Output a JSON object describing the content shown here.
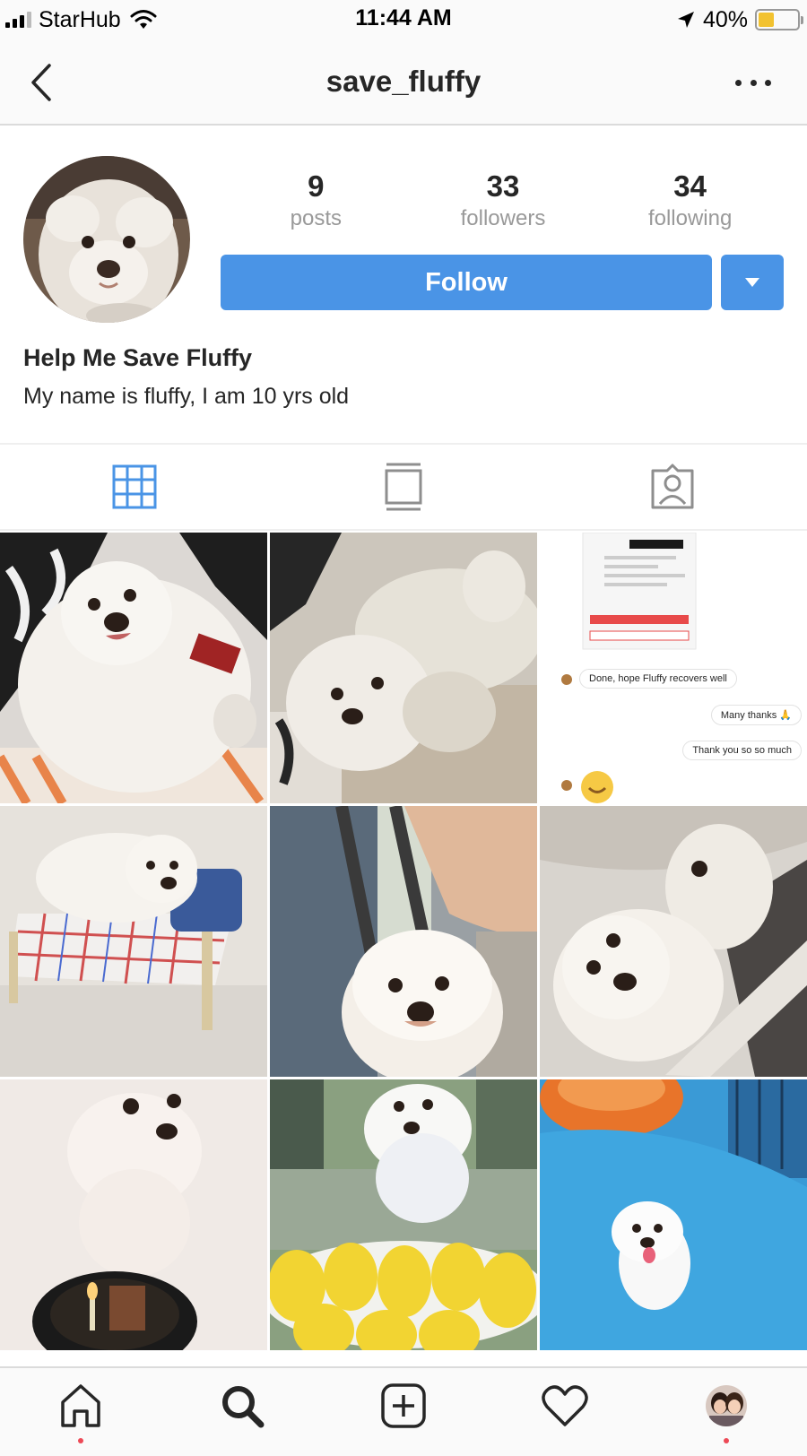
{
  "status_bar": {
    "carrier": "StarHub",
    "time": "11:44 AM",
    "battery_percent": "40%",
    "battery_level": 0.4,
    "icons": [
      "signal-icon",
      "wifi-icon",
      "location-arrow-icon",
      "battery-icon"
    ]
  },
  "header": {
    "title": "save_fluffy",
    "back_icon": "chevron-left-icon",
    "more_icon": "more-options-icon"
  },
  "profile": {
    "stats": [
      {
        "value": "9",
        "label": "posts"
      },
      {
        "value": "33",
        "label": "followers"
      },
      {
        "value": "34",
        "label": "following"
      }
    ],
    "follow_label": "Follow",
    "name": "Help Me Save Fluffy",
    "bio": "My name is fluffy, I am 10 yrs old",
    "accent_color": "#4a94e6"
  },
  "tabs": [
    {
      "icon": "grid-icon",
      "active": true
    },
    {
      "icon": "feed-list-icon",
      "active": false
    },
    {
      "icon": "tagged-photos-icon",
      "active": false
    }
  ],
  "posts": {
    "chat_screenshot": {
      "messages": [
        "Done, hope Fluffy recovers well",
        "Many thanks 🙏",
        "Thank you so so much"
      ]
    }
  },
  "bottom_nav": [
    {
      "icon": "home-icon",
      "badge": true
    },
    {
      "icon": "search-icon",
      "badge": false
    },
    {
      "icon": "new-post-icon",
      "badge": false
    },
    {
      "icon": "activity-heart-icon",
      "badge": false
    },
    {
      "icon": "profile-avatar-icon",
      "badge": true
    }
  ]
}
